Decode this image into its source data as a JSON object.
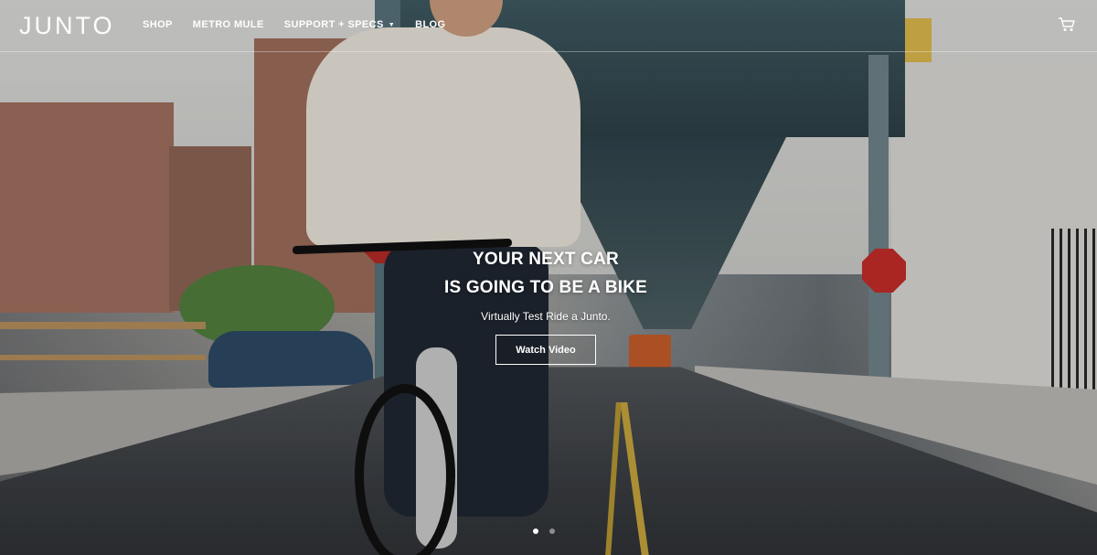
{
  "brand": {
    "logo": "JUNTO"
  },
  "nav": {
    "items": [
      {
        "label": "SHOP"
      },
      {
        "label": "METRO MULE"
      },
      {
        "label": "SUPPORT + SPECS",
        "dropdown": true
      },
      {
        "label": "BLOG"
      }
    ],
    "cart_icon": "cart-icon"
  },
  "hero": {
    "headline_line1": "YOUR NEXT CAR",
    "headline_line2": "IS GOING TO BE A BIKE",
    "subheadline": "Virtually Test Ride a Junto.",
    "cta_label": "Watch Video",
    "slide_count": 2,
    "active_slide": 1
  },
  "colors": {
    "nav_text": "#ffffff",
    "accent": "#ffffff"
  }
}
